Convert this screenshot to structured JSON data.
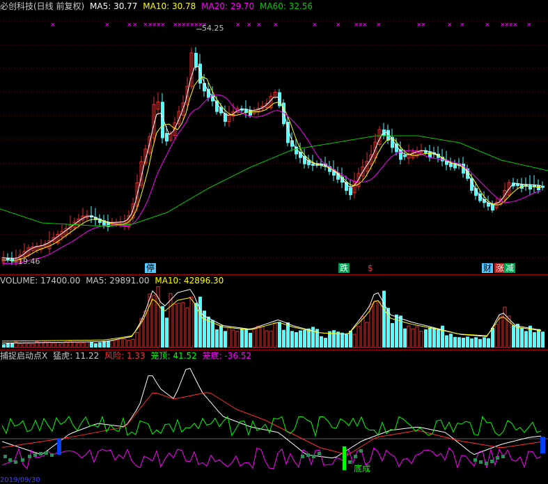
{
  "colors": {
    "up": "#e03030",
    "down": "#54ffff",
    "ma5": "#ffffff",
    "ma10": "#ffff00",
    "ma20": "#ff00ff",
    "ma60": "#00cc00",
    "risk": "#ff3030",
    "top": "#00ff00",
    "bottom": "#ff00ff",
    "tiger": "#ffffff"
  },
  "price": {
    "title": "必创科技(日线 前复权)",
    "ma5": "MA5: 30.77",
    "ma10": "MA10: 30.78",
    "ma20": "MA20: 29.70",
    "ma60": "MA60: 32.56",
    "high_label": "54.25",
    "low_label": "19.46",
    "tags": {
      "halt": "停",
      "fall": "跌",
      "dollar": "$",
      "finance": "财",
      "reduce": "减",
      "rise": "涨"
    }
  },
  "volume": {
    "vol": "VOLUME: 17400.00",
    "ma5": "MA5: 29891.00",
    "ma10": "MA10: 42896.30"
  },
  "indicator": {
    "name": "捕捉启动点X",
    "tiger": "猛虎: 11.22",
    "risk": "风险: 1.33",
    "top": "笼顶: 41.52",
    "bottom": "笼底: -36.52",
    "bottom_tag": "底成"
  },
  "axis": {
    "date": "2019/09/30"
  }
}
